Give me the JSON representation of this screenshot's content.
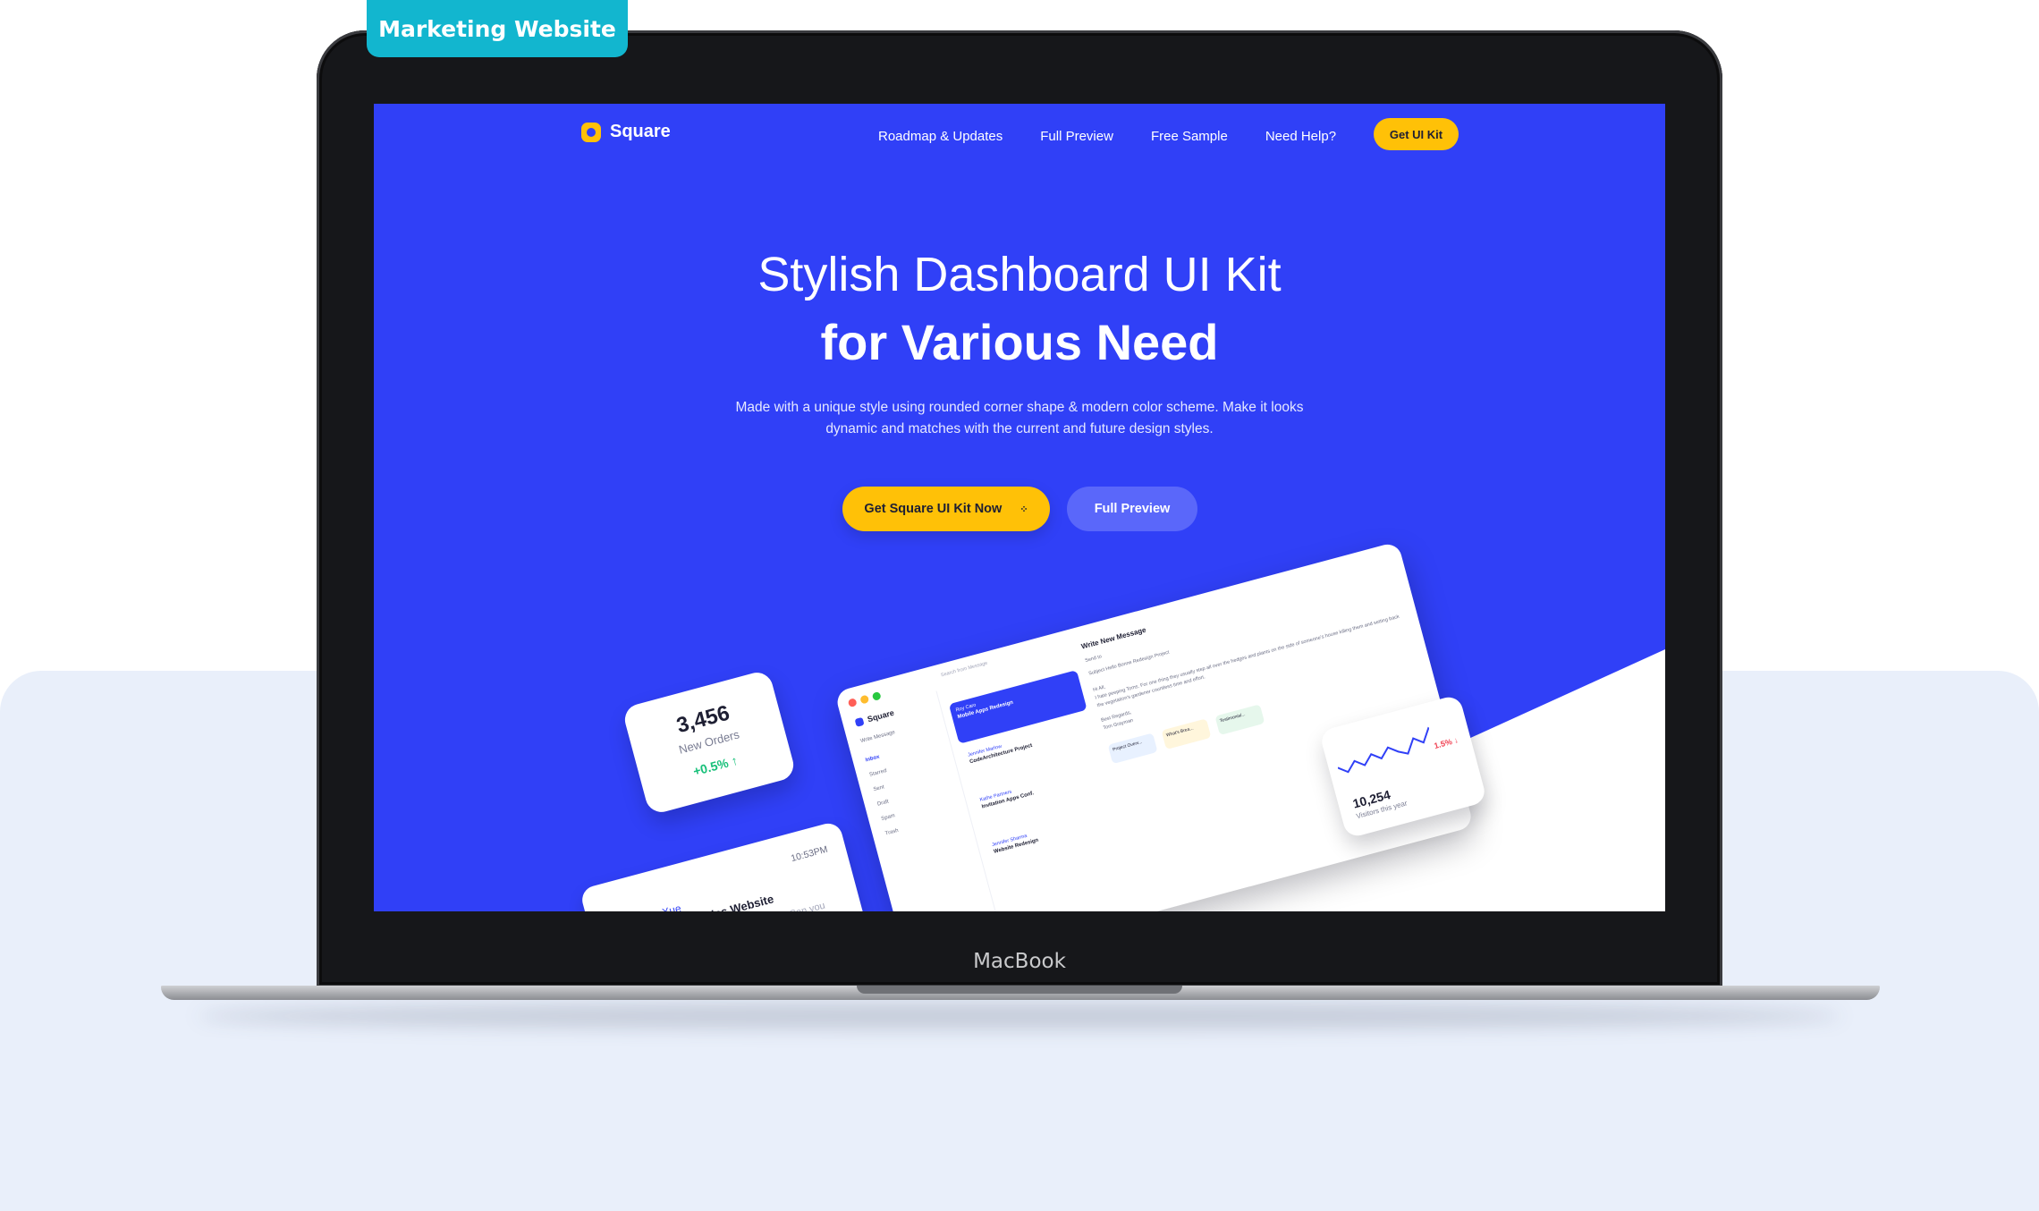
{
  "badge": {
    "label": "Marketing Website"
  },
  "device": {
    "brand": "MacBook"
  },
  "colors": {
    "primary": "#3040f7",
    "accent": "#ffc107",
    "badge": "#12b6cf",
    "success": "#18c07a",
    "danger": "#f04354"
  },
  "nav": {
    "logo": "Square",
    "links": [
      "Roadmap & Updates",
      "Full Preview",
      "Free Sample",
      "Need Help?"
    ],
    "cta": "Get UI Kit"
  },
  "hero": {
    "title_line1": "Stylish Dashboard UI Kit",
    "title_line2": "for Various Need",
    "subtitle_line1": "Made with a unique style using rounded corner shape & modern color scheme. Make it looks",
    "subtitle_line2": "dynamic and matches with the current and future design styles.",
    "primary_button": "Get Square UI Kit Now",
    "secondary_button": "Full Preview"
  },
  "orders_card": {
    "value": "3,456",
    "label": "New Orders",
    "change": "+0.5%"
  },
  "mail_card": {
    "name": "Ren Xue",
    "time": "10:53PM",
    "subject": "Zone Dynamics Website",
    "preview": "...one now? Can you"
  },
  "mockup": {
    "brand": "Square",
    "write_button": "Write Message",
    "search_placeholder": "Search from Message",
    "sidebar": [
      "Inbox",
      "Starred",
      "Sent",
      "Draft",
      "Spam",
      "Trash"
    ],
    "list": [
      {
        "from": "Roy Caro",
        "subject": "Mobile Apps Redesign"
      },
      {
        "from": "Jennifer Marlow",
        "subject": "CodeArchitecture Project"
      },
      {
        "from": "Kathe Partners",
        "subject": "Invitation Apps Conf."
      },
      {
        "from": "Jennifer Sharma",
        "subject": "Website Redesign"
      }
    ],
    "compose": {
      "title": "Write New Message",
      "send_to": "Send to",
      "subject_label": "Subject",
      "subject": "Hello Bonne Redesign Project",
      "greeting": "Hi All,",
      "body": "I hate peeping Toms. For one thing they usually step all over the hedges and plants on the side of someone's house killing them and setting back the vegetation's gardener countless time and effort.",
      "sign": "Best Regards,",
      "signer": "Tom Grayman",
      "attachments": [
        "Project Overv...",
        "What's Brea...",
        "Testimonial..."
      ]
    }
  },
  "visitors_card": {
    "value": "10,254",
    "label": "Visitors this year",
    "change": "1.5%",
    "trend": [
      0.45,
      0.6,
      0.4,
      0.55,
      0.35,
      0.5,
      0.3,
      0.45,
      0.55,
      0.25,
      0.4,
      0.1
    ]
  }
}
